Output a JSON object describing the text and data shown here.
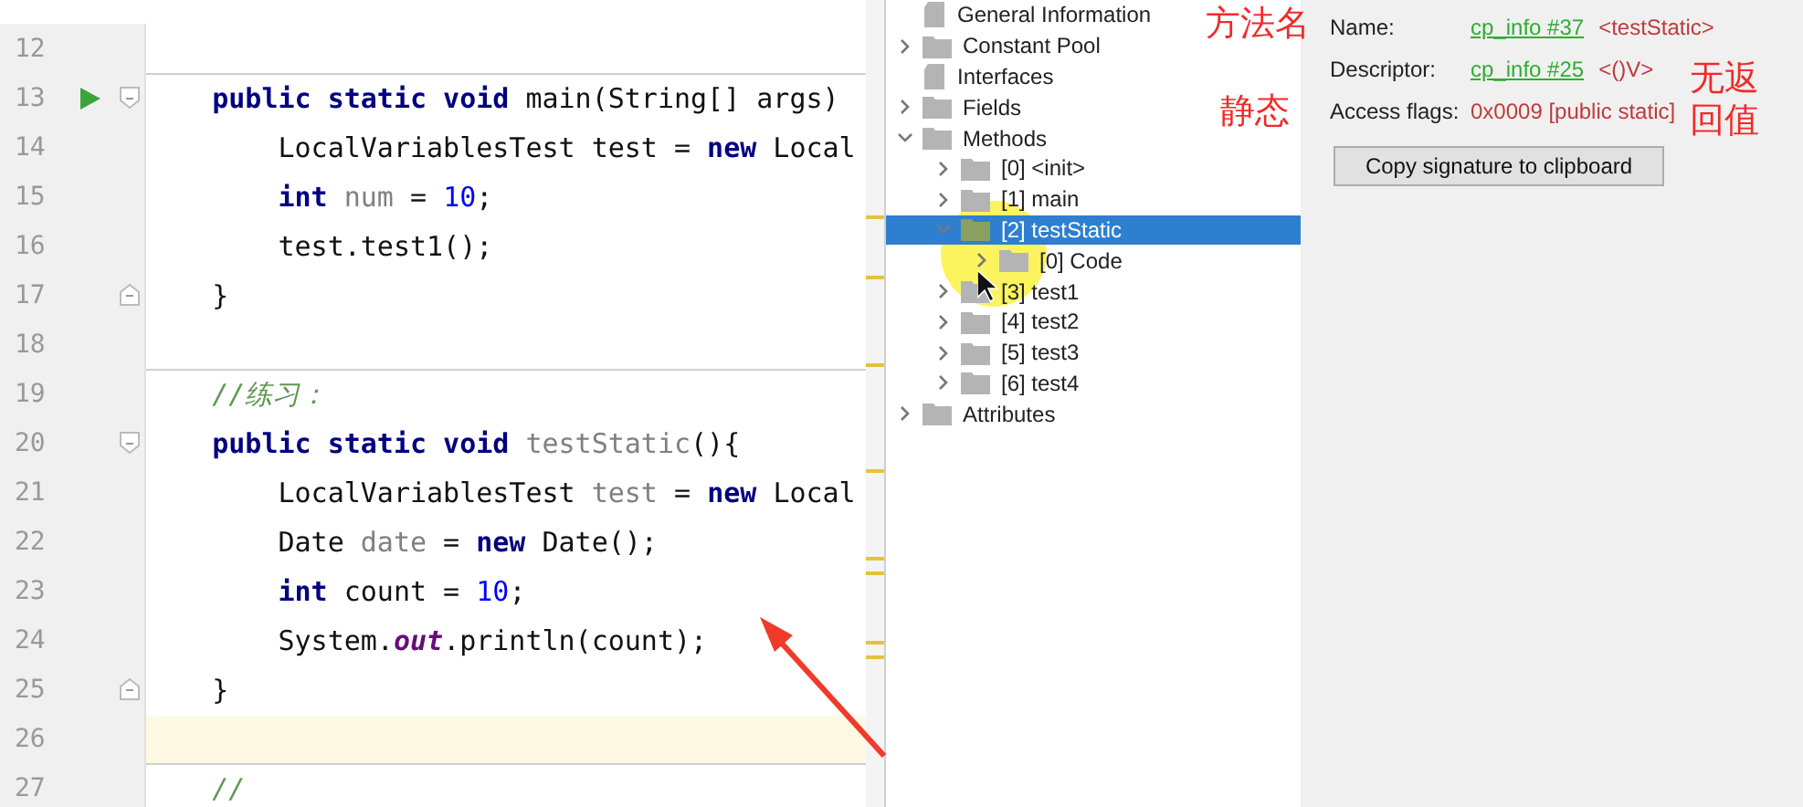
{
  "editor": {
    "lines": [
      {
        "number": "12"
      },
      {
        "number": "13",
        "run": true,
        "fold_open": true,
        "separator_above": true,
        "tokens": [
          {
            "text": "    public static void ",
            "kind": "keyword"
          },
          {
            "text": "main(String[] args)",
            "kind": "plain"
          }
        ]
      },
      {
        "number": "14",
        "tokens": [
          {
            "text": "        LocalVariablesTest test = ",
            "kind": "plain"
          },
          {
            "text": "new ",
            "kind": "keyword"
          },
          {
            "text": "Local",
            "kind": "plain"
          }
        ]
      },
      {
        "number": "15",
        "tokens": [
          {
            "text": "        int ",
            "kind": "keyword"
          },
          {
            "text": "num",
            "kind": "unused"
          },
          {
            "text": " = ",
            "kind": "plain"
          },
          {
            "text": "10",
            "kind": "number"
          },
          {
            "text": ";",
            "kind": "plain"
          }
        ]
      },
      {
        "number": "16",
        "tokens": [
          {
            "text": "        test.test1();",
            "kind": "plain"
          }
        ]
      },
      {
        "number": "17",
        "fold_close": true,
        "tokens": [
          {
            "text": "    }",
            "kind": "plain"
          }
        ]
      },
      {
        "number": "18"
      },
      {
        "number": "19",
        "separator_above": true,
        "tokens": [
          {
            "text": "    //练习：",
            "kind": "comment"
          }
        ]
      },
      {
        "number": "20",
        "fold_open": true,
        "tokens": [
          {
            "text": "    public static void ",
            "kind": "keyword"
          },
          {
            "text": "testStatic",
            "kind": "unused"
          },
          {
            "text": "(){",
            "kind": "plain"
          }
        ]
      },
      {
        "number": "21",
        "tokens": [
          {
            "text": "        LocalVariablesTest ",
            "kind": "plain"
          },
          {
            "text": "test",
            "kind": "unused"
          },
          {
            "text": " = ",
            "kind": "plain"
          },
          {
            "text": "new ",
            "kind": "keyword"
          },
          {
            "text": "Local",
            "kind": "plain"
          }
        ]
      },
      {
        "number": "22",
        "tokens": [
          {
            "text": "        Date ",
            "kind": "plain"
          },
          {
            "text": "date",
            "kind": "unused"
          },
          {
            "text": " = ",
            "kind": "plain"
          },
          {
            "text": "new ",
            "kind": "keyword"
          },
          {
            "text": "Date();",
            "kind": "plain"
          }
        ]
      },
      {
        "number": "23",
        "tokens": [
          {
            "text": "        int ",
            "kind": "keyword"
          },
          {
            "text": "count = ",
            "kind": "plain"
          },
          {
            "text": "10",
            "kind": "number"
          },
          {
            "text": ";",
            "kind": "plain"
          }
        ]
      },
      {
        "number": "24",
        "tokens": [
          {
            "text": "        System.",
            "kind": "plain"
          },
          {
            "text": "out",
            "kind": "static_field"
          },
          {
            "text": ".println(count);",
            "kind": "plain"
          }
        ]
      },
      {
        "number": "25",
        "fold_close": true,
        "tokens": [
          {
            "text": "    }",
            "kind": "plain"
          }
        ]
      },
      {
        "number": "26",
        "current": true
      },
      {
        "number": "27",
        "separator_above": true,
        "tokens": [
          {
            "text": "    //",
            "kind": "comment"
          }
        ]
      }
    ]
  },
  "tree": [
    {
      "label": "General Information",
      "kind": "file",
      "selected": false
    },
    {
      "label": "Constant Pool",
      "kind": "folder",
      "expanded": false,
      "selected": false
    },
    {
      "label": "Interfaces",
      "kind": "file",
      "selected": false
    },
    {
      "label": "Fields",
      "kind": "folder",
      "expanded": false,
      "selected": false
    },
    {
      "label": "Methods",
      "kind": "folder",
      "expanded": true,
      "selected": false,
      "children": [
        {
          "label": "[0] <init>",
          "kind": "folder",
          "expanded": false,
          "selected": false
        },
        {
          "label": "[1] main",
          "kind": "folder",
          "expanded": false,
          "selected": false
        },
        {
          "label": "[2] testStatic",
          "kind": "folder",
          "expanded": true,
          "selected": true,
          "children": [
            {
              "label": "[0] Code",
              "kind": "folder",
              "expanded": false,
              "selected": false
            }
          ]
        },
        {
          "label": "[3] test1",
          "kind": "folder",
          "expanded": false,
          "selected": false
        },
        {
          "label": "[4] test2",
          "kind": "folder",
          "expanded": false,
          "selected": false
        },
        {
          "label": "[5] test3",
          "kind": "folder",
          "expanded": false,
          "selected": false
        },
        {
          "label": "[6] test4",
          "kind": "folder",
          "expanded": false,
          "selected": false
        }
      ]
    },
    {
      "label": "Attributes",
      "kind": "folder",
      "expanded": false,
      "selected": false
    }
  ],
  "details": {
    "rows": [
      {
        "label": "Name:",
        "link": "cp_info #37",
        "value": "<testStatic>"
      },
      {
        "label": "Descriptor:",
        "link": "cp_info #25",
        "value": "<()V>"
      },
      {
        "label": "Access flags:",
        "value": "0x0009 [public static]"
      }
    ],
    "button": "Copy signature to clipboard"
  },
  "annotations": [
    "方法名",
    "静态",
    "无返回值"
  ]
}
